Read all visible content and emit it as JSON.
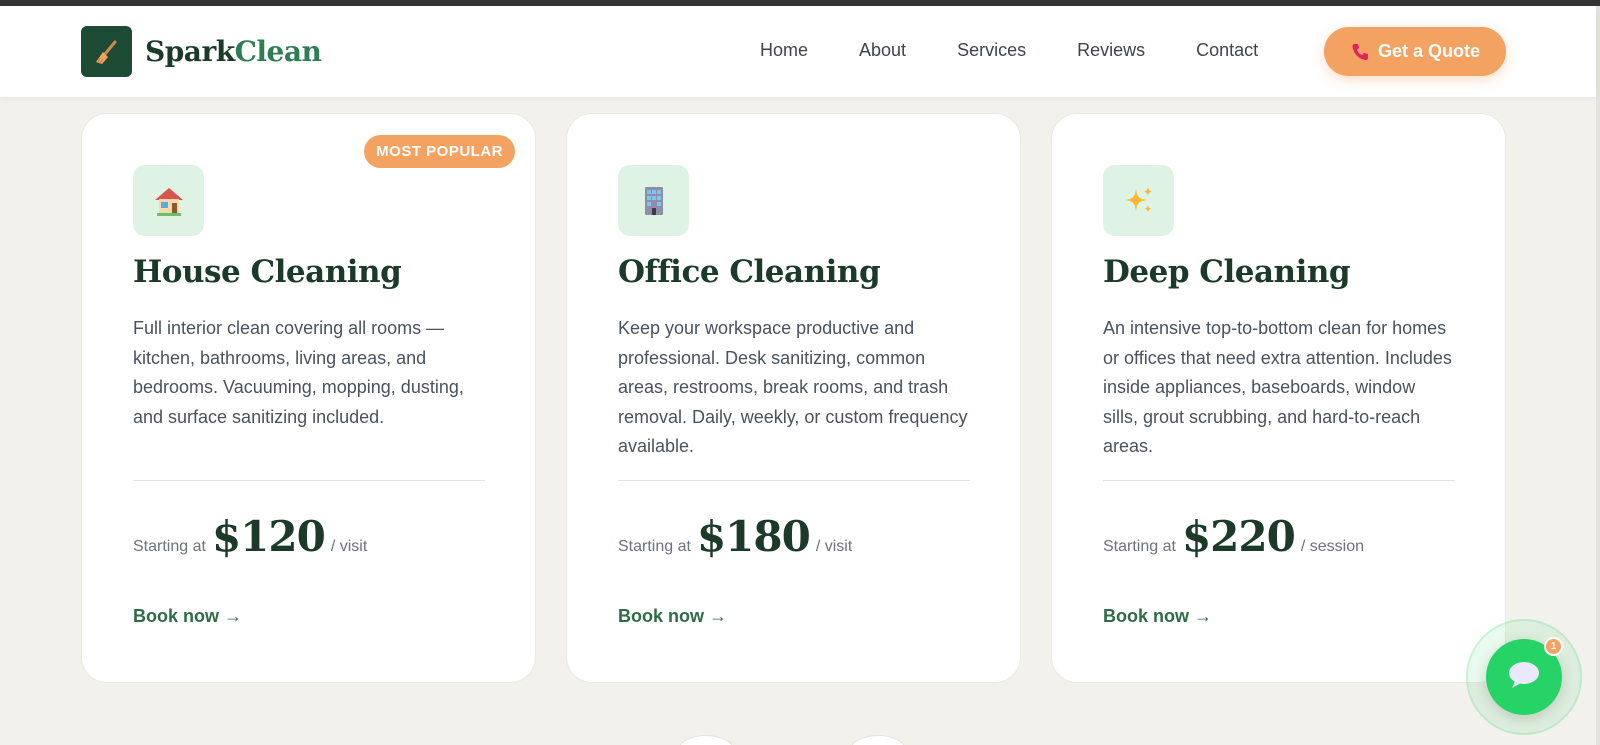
{
  "brand": {
    "name_part1": "Spark",
    "name_part2": "Clean"
  },
  "nav": {
    "items": [
      "Home",
      "About",
      "Services",
      "Reviews",
      "Contact"
    ]
  },
  "quote_button": "Get a Quote",
  "cards": [
    {
      "badge": "MOST POPULAR",
      "icon": "house-icon",
      "title": "House Cleaning",
      "description": "Full interior clean covering all rooms — kitchen, bathrooms, living areas, and bedrooms. Vacuuming, mopping, dusting, and surface sanitizing included.",
      "price_prefix": "Starting at",
      "price": "$120",
      "price_unit": "/ visit",
      "cta": "Book now →"
    },
    {
      "icon": "office-building-icon",
      "title": "Office Cleaning",
      "description": "Keep your workspace productive and professional. Desk sanitizing, common areas, restrooms, break rooms, and trash removal. Daily, weekly, or custom frequency available.",
      "price_prefix": "Starting at",
      "price": "$180",
      "price_unit": "/ visit",
      "cta": "Book now →"
    },
    {
      "icon": "sparkles-icon",
      "title": "Deep Cleaning",
      "description": "An intensive top-to-bottom clean for homes or offices that need extra attention. Includes inside appliances, baseboards, window sills, grout scrubbing, and hard-to-reach areas.",
      "price_prefix": "Starting at",
      "price": "$220",
      "price_unit": "/ session",
      "cta": "Book now →"
    }
  ],
  "chat": {
    "badge_count": "1",
    "icon": "chat-bubble-icon"
  },
  "colors": {
    "primary": "#1e4b35",
    "accent": "#f4a261",
    "chat": "#25d366",
    "background": "#f3f1ec"
  }
}
